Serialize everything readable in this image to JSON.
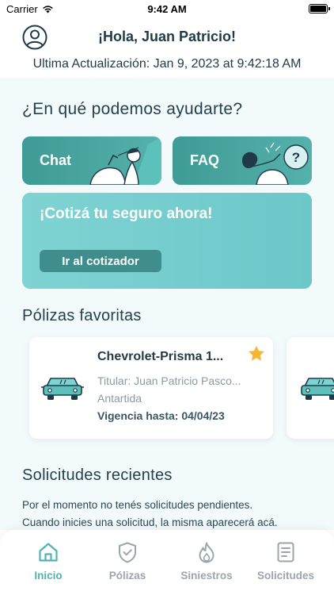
{
  "status_bar": {
    "carrier": "Carrier",
    "time": "9:42 AM"
  },
  "header": {
    "greeting": "¡Hola, Juan Patricio!",
    "last_update": "Ultima Actualización: Jan 9, 2023 at 9:42:18 AM"
  },
  "help": {
    "title": "¿En qué podemos ayudarte?",
    "chat_label": "Chat",
    "faq_label": "FAQ",
    "quote_title": "¡Cotizá tu seguro ahora!",
    "quote_button": "Ir al cotizador"
  },
  "favorites": {
    "title": "Pólizas favoritas",
    "policies": [
      {
        "name": "Chevrolet-Prisma 1...",
        "holder": "Titular: Juan Patricio Pasco...",
        "location": "Antartida",
        "validity": "Vigencia hasta: 04/04/23",
        "icon": "car-icon",
        "favorite_icon": "star-icon"
      }
    ]
  },
  "requests": {
    "title": "Solicitudes recientes",
    "empty_line1": "Por el momento no tenés solicitudes pendientes.",
    "empty_line2": "Cuando inicies una solicitud, la misma aparecerá acá."
  },
  "tab_bar": {
    "tabs": [
      {
        "label": "Inicio",
        "icon": "home-icon",
        "active": true
      },
      {
        "label": "Pólizas",
        "icon": "shield-check-icon",
        "active": false
      },
      {
        "label": "Siniestros",
        "icon": "flame-icon",
        "active": false
      },
      {
        "label": "Solicitudes",
        "icon": "document-icon",
        "active": false
      }
    ]
  },
  "colors": {
    "accent": "#4fb3b4",
    "card_teal": "#3f9b96",
    "card_light_teal": "#7fd3d3",
    "text_dark": "#24404f",
    "star": "#f5b731"
  }
}
